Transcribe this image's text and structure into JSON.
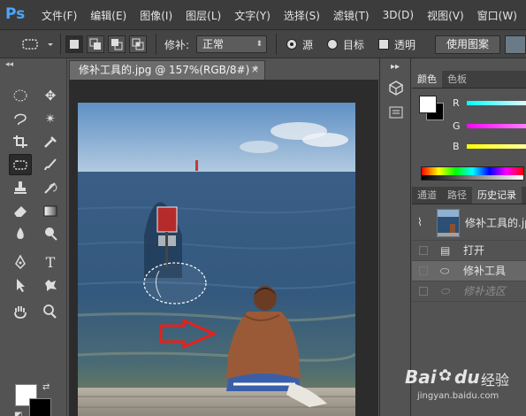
{
  "app": {
    "logo": "Ps"
  },
  "menu": [
    "文件(F)",
    "编辑(E)",
    "图像(I)",
    "图层(L)",
    "文字(Y)",
    "选择(S)",
    "滤镜(T)",
    "3D(D)",
    "视图(V)",
    "窗口(W)"
  ],
  "options": {
    "patch_label": "修补:",
    "patch_mode": "正常",
    "source_label": "源",
    "target_label": "目标",
    "transparent_label": "透明",
    "use_pattern_label": "使用图案"
  },
  "document": {
    "tab_title": "修补工具的.jpg @ 157%(RGB/8#) *",
    "close": "×"
  },
  "color_panel": {
    "tabs": [
      "颜色",
      "色板"
    ],
    "labels": [
      "R",
      "G",
      "B"
    ],
    "colors": {
      "r_slider": "#00e8ff",
      "g_slider": "#ff40ff",
      "b_slider": "#ffff00"
    }
  },
  "history_panel": {
    "tabs": [
      "通道",
      "路径",
      "历史记录"
    ],
    "snapshot": "修补工具的.jp",
    "items": [
      {
        "label": "打开",
        "state": "normal"
      },
      {
        "label": "修补工具",
        "state": "selected"
      },
      {
        "label": "修补选区",
        "state": "dimmed"
      }
    ]
  },
  "watermark": {
    "brand": "Bai",
    "brand2": "du",
    "text": "经验",
    "url": "jingyan.baidu.com"
  },
  "colors": {
    "accent": "#4aa6ff",
    "panel": "#535353",
    "menubar": "#3c3c3c",
    "arrow": "#e8201a"
  }
}
